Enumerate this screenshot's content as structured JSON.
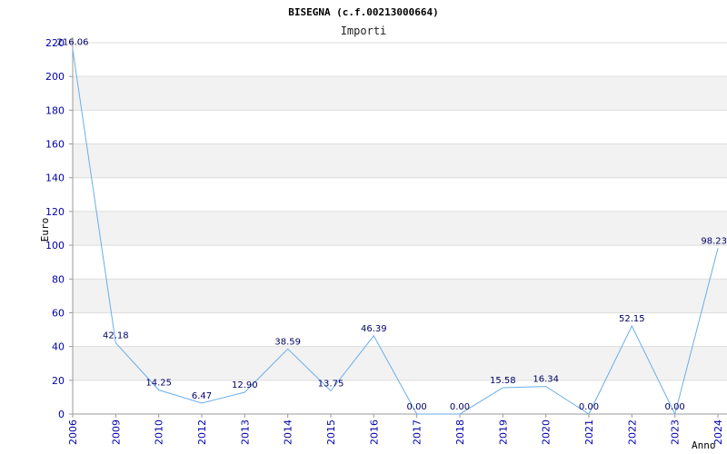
{
  "chart_data": {
    "type": "line",
    "title": "BISEGNA (c.f.00213000664)",
    "subtitle": "Importi",
    "xlabel": "Anno",
    "ylabel": "Euro",
    "categories": [
      "2006",
      "2009",
      "2010",
      "2012",
      "2013",
      "2014",
      "2015",
      "2016",
      "2017",
      "2018",
      "2019",
      "2020",
      "2021",
      "2022",
      "2023",
      "2024"
    ],
    "series": [
      {
        "values": [
          216.06,
          42.18,
          14.25,
          6.47,
          12.9,
          38.59,
          13.75,
          46.39,
          0.0,
          0.0,
          15.58,
          16.34,
          0.0,
          52.15,
          0.0,
          98.23
        ],
        "labels": [
          "216.06",
          "42.18",
          "14.25",
          "6.47",
          "12.90",
          "38.59",
          "13.75",
          "46.39",
          "0.00",
          "0.00",
          "15.58",
          "16.34",
          "0.00",
          "52.15",
          "0.00",
          "98.23"
        ]
      }
    ],
    "ylim": [
      0,
      220
    ],
    "yticks": [
      "0",
      "20",
      "40",
      "60",
      "80",
      "100",
      "120",
      "140",
      "160",
      "180",
      "200",
      "220"
    ],
    "grid": true,
    "colors": {
      "line": "#6aaee8",
      "tick_text": "#0000aa",
      "label_text": "#000066",
      "band": "#f2f2f2",
      "grid": "#dddddd",
      "axis": "#999999"
    }
  }
}
